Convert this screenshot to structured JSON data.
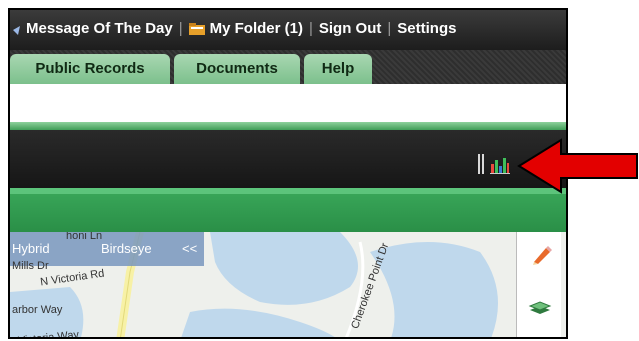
{
  "topnav": {
    "message_of_the_day": "Message Of The Day",
    "my_folder": "My Folder (1)",
    "sign_out": "Sign Out",
    "settings": "Settings"
  },
  "tabs": [
    "Public Records",
    "Documents",
    "Help"
  ],
  "map": {
    "view_hybrid": "Hybrid",
    "view_birdseye": "Birdseye",
    "collapse": "<<",
    "streets": {
      "honi_ln": "honi Ln",
      "mills_dr": "Mills Dr",
      "n_victoria_rd": "N Victoria Rd",
      "harbor_way": "arbor Way",
      "victoria_way": "Victoria Way",
      "cherokee_point_dr": "Cherokee Point Dr"
    }
  },
  "colors": {
    "tab_green": "#7cc08c",
    "band_green": "#2a8f47",
    "toolbar_dark": "#1c1c1c",
    "arrow_red": "#e30000"
  },
  "icons": [
    "message-icon",
    "folder-icon",
    "toolbar-handle-icon",
    "chart-icon",
    "pencil-icon",
    "layers-icon"
  ]
}
